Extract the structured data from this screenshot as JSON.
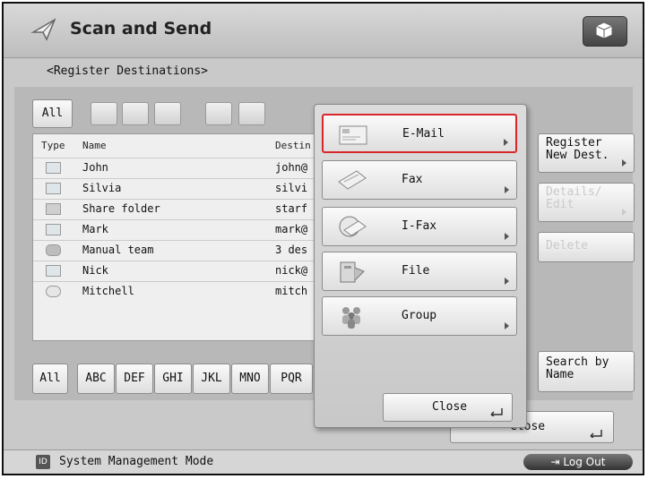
{
  "header": {
    "title": "Scan and Send"
  },
  "page": {
    "subtitle": "<Register Destinations>"
  },
  "filters": {
    "all_label": "All"
  },
  "table": {
    "headers": {
      "type": "Type",
      "name": "Name",
      "destination": "Destin"
    },
    "rows": [
      {
        "icon": "email-icon",
        "name": "John",
        "dest": "john@"
      },
      {
        "icon": "email-icon",
        "name": "Silvia",
        "dest": "silvi"
      },
      {
        "icon": "file-icon",
        "name": "Share folder",
        "dest": "starf"
      },
      {
        "icon": "email-icon",
        "name": "Mark",
        "dest": "mark@"
      },
      {
        "icon": "group-icon",
        "name": "Manual team",
        "dest": "3 des"
      },
      {
        "icon": "email-icon",
        "name": "Nick",
        "dest": "nick@"
      },
      {
        "icon": "ifax-icon",
        "name": "Mitchell",
        "dest": "mitch"
      }
    ]
  },
  "alpha": {
    "all": "All",
    "tabs": [
      "ABC",
      "DEF",
      "GHI",
      "JKL",
      "MNO",
      "PQR"
    ]
  },
  "right": {
    "register": "Register New Dest.",
    "details": "Details/ Edit",
    "delete": "Delete",
    "search": "Search by Name",
    "close": "Close"
  },
  "popup": {
    "items": [
      "E-Mail",
      "Fax",
      "I-Fax",
      "File",
      "Group"
    ],
    "close": "Close"
  },
  "status": {
    "mode": "System Management Mode",
    "mode_icon_text": "ID",
    "logout": "Log Out"
  }
}
